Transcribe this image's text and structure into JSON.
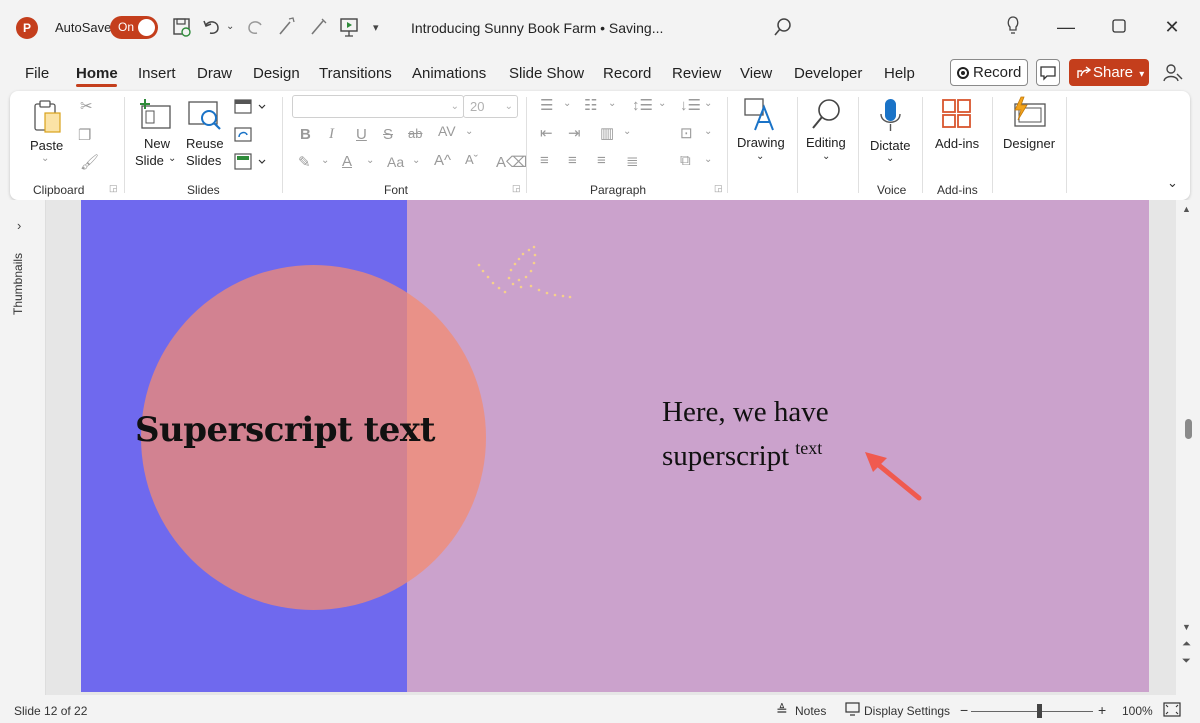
{
  "app": {
    "logo_letter": "P",
    "autosave_label": "AutoSave",
    "autosave_state": "On",
    "document_title": "Introducing Sunny Book Farm • Saving...",
    "accent_color": "#c43e1c"
  },
  "menu": {
    "tabs": [
      "File",
      "Home",
      "Insert",
      "Draw",
      "Design",
      "Transitions",
      "Animations",
      "Slide Show",
      "Record",
      "Review",
      "View",
      "Developer",
      "Help"
    ],
    "active_tab": "Home",
    "record_label": "Record",
    "share_label": "Share"
  },
  "ribbon": {
    "clipboard": {
      "paste_label": "Paste",
      "group_label": "Clipboard"
    },
    "slides": {
      "new_slide_line1": "New",
      "new_slide_line2": "Slide",
      "reuse_line1": "Reuse",
      "reuse_line2": "Slides",
      "group_label": "Slides"
    },
    "font": {
      "font_name": "",
      "font_size": "20",
      "group_label": "Font"
    },
    "paragraph": {
      "group_label": "Paragraph"
    },
    "drawing": {
      "label": "Drawing"
    },
    "editing": {
      "label": "Editing"
    },
    "voice": {
      "dictate_label": "Dictate",
      "group_label": "Voice"
    },
    "addins": {
      "label": "Add-ins",
      "group_label": "Add-ins"
    },
    "designer": {
      "label": "Designer"
    }
  },
  "thumbnails": {
    "label": "Thumbnails"
  },
  "slide": {
    "title": "Superscript text",
    "body_line1": "Here, we have",
    "body_line2": "superscript",
    "body_superscript": "text",
    "colors": {
      "left_panel": "#6f69ee",
      "background": "#cba2cc",
      "circle": "#f38b72",
      "arrow": "#f05a4f"
    }
  },
  "status": {
    "slide_info": "Slide 12 of 22",
    "notes_label": "Notes",
    "display_settings_label": "Display Settings",
    "zoom_minus": "−",
    "zoom_plus": "+",
    "zoom_level": "100%"
  }
}
